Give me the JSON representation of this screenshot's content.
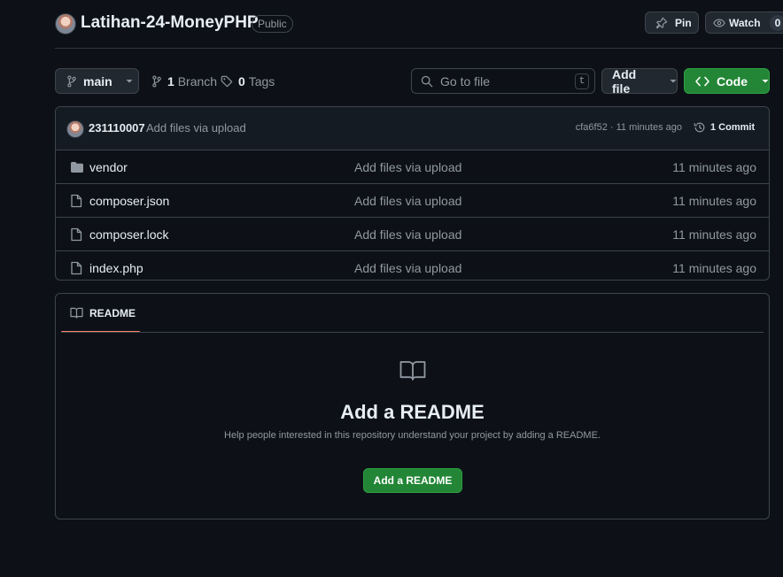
{
  "repo": {
    "name": "Latihan-24-MoneyPHP",
    "visibility": "Public"
  },
  "actions": {
    "pin_label": "Pin",
    "watch_label": "Watch",
    "watch_count": "0"
  },
  "toolbar": {
    "branch": "main",
    "branch_count": "1",
    "branch_label": "Branch",
    "tag_count": "0",
    "tag_label": "Tags",
    "goto_placeholder": "Go to file",
    "goto_shortcut": "t",
    "add_file_label": "Add file",
    "code_label": "Code"
  },
  "commit": {
    "author": "231110007",
    "message": "Add files via upload",
    "meta": "cfa6f52 · 11 minutes ago",
    "commits_count_label": "1 Commit"
  },
  "files": [
    {
      "name": "vendor",
      "type": "folder",
      "message": "Add files via upload",
      "date": "11 minutes ago"
    },
    {
      "name": "composer.json",
      "type": "file",
      "message": "Add files via upload",
      "date": "11 minutes ago"
    },
    {
      "name": "composer.lock",
      "type": "file",
      "message": "Add files via upload",
      "date": "11 minutes ago"
    },
    {
      "name": "index.php",
      "type": "file",
      "message": "Add files via upload",
      "date": "11 minutes ago"
    }
  ],
  "readme": {
    "tab_label": "README",
    "heading": "Add a README",
    "description": "Help people interested in this repository understand your project by adding a README.",
    "button_label": "Add a README"
  },
  "colors": {
    "background": "#0d1117",
    "border": "#3d444d",
    "accent_green": "#238636",
    "tab_underline": "#f78166",
    "muted_text": "#9198a1"
  },
  "icons": [
    "pin-icon",
    "eye-icon",
    "branch-icon",
    "tag-icon",
    "search-icon",
    "chevron-down-icon",
    "code-icon",
    "history-icon",
    "folder-icon",
    "file-icon",
    "book-icon"
  ]
}
